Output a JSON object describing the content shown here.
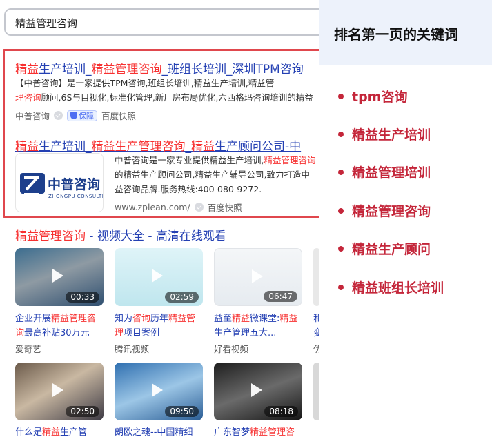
{
  "search": {
    "query": "精益管理咨询"
  },
  "results": [
    {
      "title_parts": [
        "精益",
        "生产培训_",
        "精益管理咨询",
        "_班组长培训_深圳TPM咨询"
      ],
      "snippet1_parts": [
        "【中普咨询】是一家提供TPM咨询,班组长培训,精益生产培训,精益管"
      ],
      "snippet2_parts": [
        "理咨询",
        "顾问,6S与目视化,标准化管理,新厂房布局优化,六西格玛咨询培训的精益"
      ],
      "source": "中普咨询",
      "badge": "保障",
      "snapshot": "百度快照"
    },
    {
      "title_parts": [
        "精益",
        "生产培训_",
        "精益",
        "生产",
        "管理咨询",
        "_",
        "精益",
        "生产顾问公司-中"
      ],
      "snippet_lines": [
        [
          "中普咨询是一家专业提供精益生产培训,",
          "精益管理咨询"
        ],
        [
          "的精益生产顾问公司,精益生产辅导公司,致力打造中"
        ],
        [
          "益咨询品牌.服务热线:400-080-9272."
        ]
      ],
      "url": "www.zplean.com/",
      "snapshot": "百度快照",
      "logo_text": "中普咨询",
      "logo_sub": "ZHONGPU CONSULTING"
    }
  ],
  "video_section": {
    "title_parts": [
      "精益管理咨询",
      " - 视频大全 - 高清在线观看"
    ],
    "videos": [
      {
        "duration": "00:33",
        "title_parts": [
          "企业开展",
          "精益管理咨",
          "询",
          "最高补贴30万元"
        ],
        "source": "爱奇艺"
      },
      {
        "duration": "02:59",
        "title_parts": [
          "知为",
          "咨询",
          "历年",
          "精益管",
          "理",
          "项目案例"
        ],
        "source": "腾讯视频"
      },
      {
        "duration": "06:47",
        "title_parts": [
          "益至",
          "精益",
          "微课堂:",
          "精",
          "益",
          "生产管理五大..."
        ],
        "source": "好看视频"
      },
      {
        "duration": "02:50",
        "title_parts": [
          "什么是",
          "精益",
          "生产管"
        ],
        "source": ""
      },
      {
        "duration": "09:50",
        "title_parts": [
          "朗欧之魂--中国精细"
        ],
        "source": ""
      },
      {
        "duration": "08:18",
        "title_parts": [
          "广东智梦",
          "精益管理咨"
        ],
        "source": ""
      }
    ],
    "partial_col_glyphs": [
      "和",
      "变",
      "伪"
    ]
  },
  "keywords_panel": {
    "title": "排名第一页的关键词",
    "items": [
      "tpm咨询",
      "精益生产培训",
      "精益管理培训",
      "精益管理咨询",
      "精益生产顾问",
      "精益班组长培训"
    ],
    "accent": "#c4263a"
  }
}
